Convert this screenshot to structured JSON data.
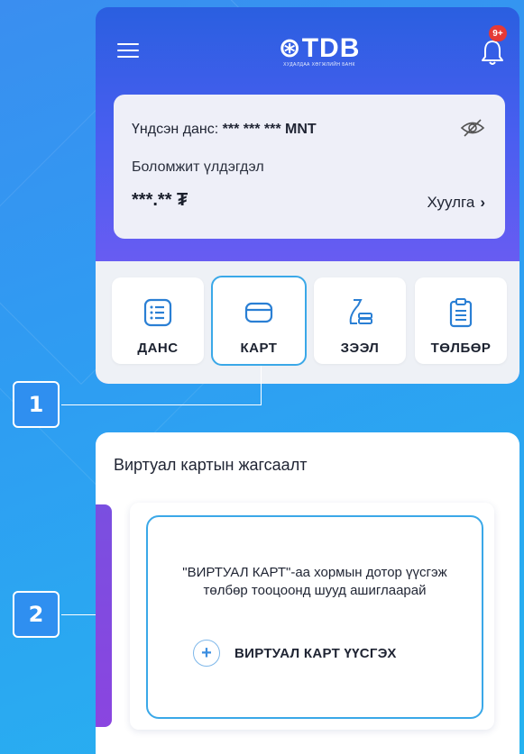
{
  "header": {
    "logo_text": "TDB",
    "logo_subtitle": "ХУДАЛДАА ХӨГЖЛИЙН БАНК",
    "notification_badge": "9+"
  },
  "balance": {
    "account_label": "Үндсэн данс:",
    "account_number": "*** *** *** MNT",
    "available_label": "Боломжит үлдэгдэл",
    "amount": "***.** ₮",
    "statement_label": "Хуулга",
    "statement_chevron": "›"
  },
  "services": [
    {
      "label": "ДАНС",
      "icon": "list-icon"
    },
    {
      "label": "КАРТ",
      "icon": "card-icon"
    },
    {
      "label": "ЗЭЭЛ",
      "icon": "money-bag-icon"
    },
    {
      "label": "ТӨЛБӨР",
      "icon": "clipboard-icon"
    }
  ],
  "callouts": [
    "1",
    "2"
  ],
  "virtual_cards": {
    "title": "Виртуал картын жагсаалт",
    "description": "\"ВИРТУАЛ КАРТ\"-аа хормын дотор үүсгэж төлбөр тооцоонд шууд ашиглаарай",
    "create_label": "ВИРТУАЛ КАРТ ҮҮСГЭХ",
    "create_icon": "+"
  },
  "colors": {
    "background": "#2f9cf2",
    "highlight": "#3aa8e8",
    "badge": "#e53935",
    "purple": "#7a4fe0"
  }
}
